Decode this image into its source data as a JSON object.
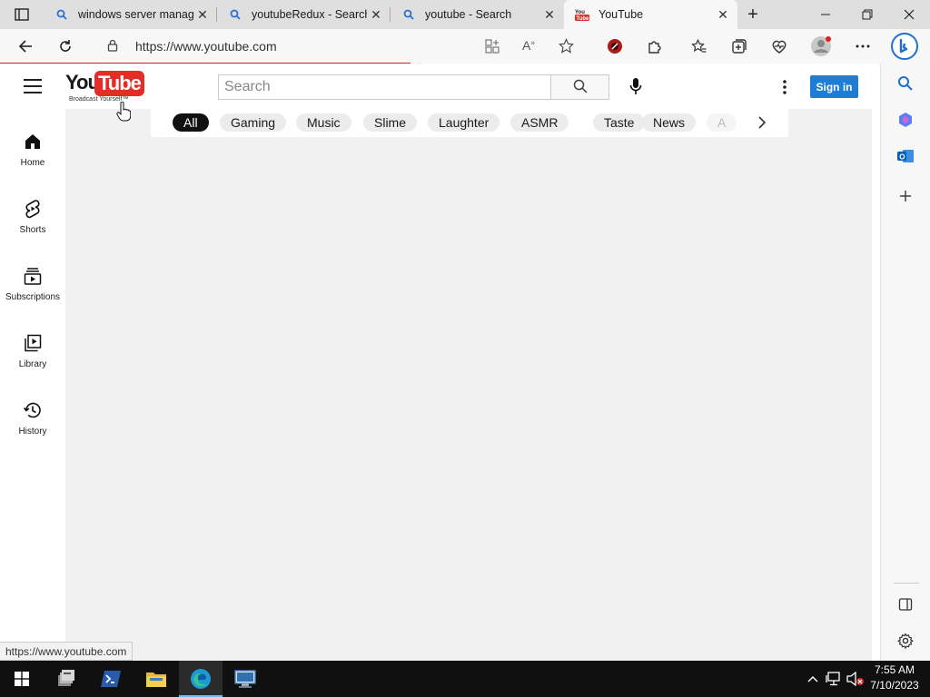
{
  "browser": {
    "tabs": [
      {
        "title": "windows server manage",
        "icon": "bing-search-icon",
        "active": false
      },
      {
        "title": "youtubeRedux - Search",
        "icon": "bing-search-icon",
        "active": false
      },
      {
        "title": "youtube - Search",
        "icon": "bing-search-icon",
        "active": false
      },
      {
        "title": "YouTube",
        "icon": "youtube-favicon",
        "active": true
      }
    ],
    "address_url": "https://www.youtube.com",
    "status_url": "https://www.youtube.com",
    "colors": {
      "load_progress": "#e02020",
      "edge_accent": "#0078d4"
    }
  },
  "youtube": {
    "logo": {
      "you": "You",
      "tube": "Tube",
      "tagline": "Broadcast Yourself™"
    },
    "search_placeholder": "Search",
    "signin_label": "Sign in",
    "guide": [
      {
        "label": "Home",
        "icon": "home-icon"
      },
      {
        "label": "Shorts",
        "icon": "shorts-icon"
      },
      {
        "label": "Subscriptions",
        "icon": "subscriptions-icon"
      },
      {
        "label": "Library",
        "icon": "library-icon"
      },
      {
        "label": "History",
        "icon": "history-icon"
      }
    ],
    "chips": [
      "All",
      "Gaming",
      "Music",
      "Slime",
      "Laughter",
      "ASMR",
      "Taste",
      "News",
      "A"
    ],
    "active_chip": "All",
    "colors": {
      "signin_bg": "#1c7ed6",
      "logo_red": "#e52d27",
      "content_bg": "#f1f1f1"
    }
  },
  "taskbar": {
    "time": "7:55 AM",
    "date": "7/10/2023",
    "apps": [
      "start-icon",
      "server-manager-icon",
      "powershell-icon",
      "file-explorer-icon",
      "edge-icon",
      "remote-desktop-icon"
    ]
  }
}
